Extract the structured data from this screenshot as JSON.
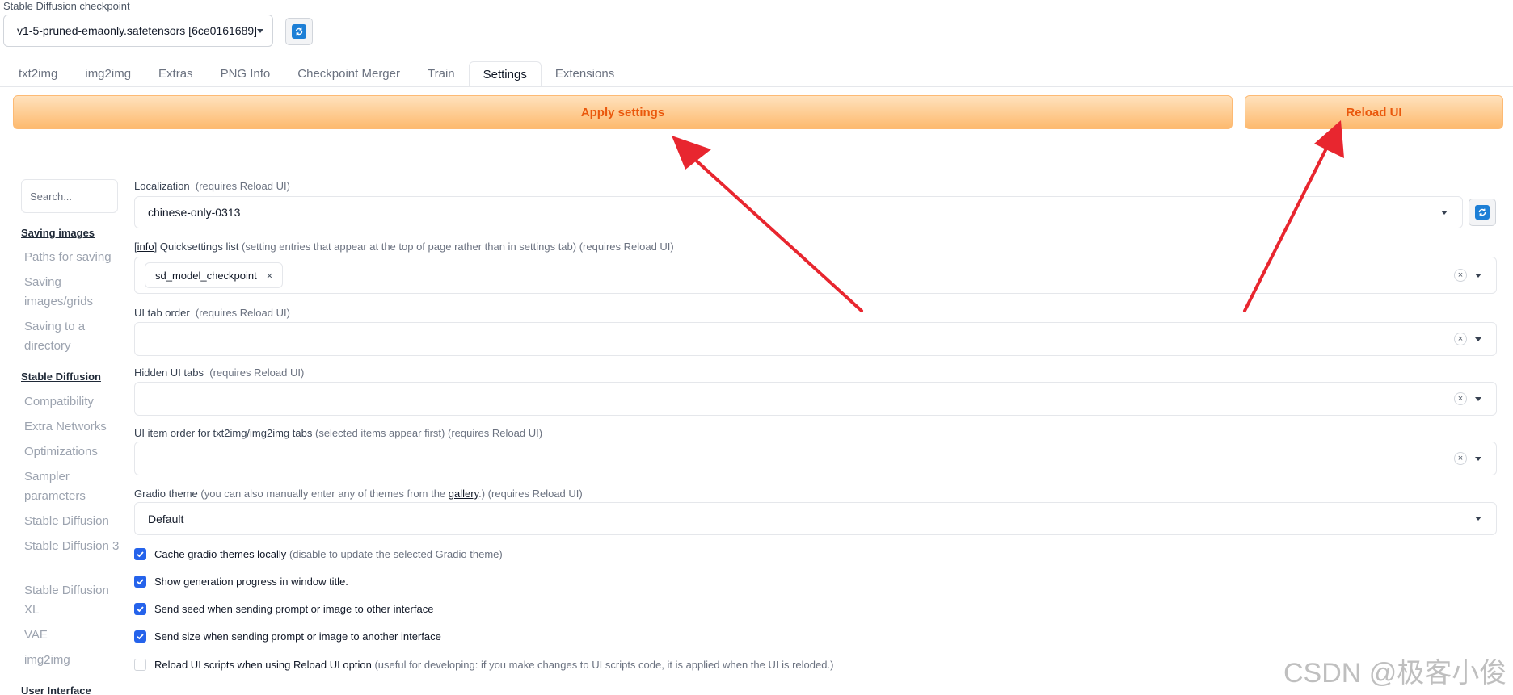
{
  "checkpoint": {
    "label": "Stable Diffusion checkpoint",
    "value": "v1-5-pruned-emaonly.safetensors [6ce0161689]",
    "refresh_icon": "refresh-icon"
  },
  "tabs": [
    "txt2img",
    "img2img",
    "Extras",
    "PNG Info",
    "Checkpoint Merger",
    "Train",
    "Settings",
    "Extensions"
  ],
  "active_tab": "Settings",
  "buttons": {
    "apply": "Apply settings",
    "reload": "Reload UI"
  },
  "sidebar": {
    "search_placeholder": "Search...",
    "groups": [
      {
        "title": "Saving images",
        "items": [
          "Paths for saving",
          "Saving images/grids",
          "Saving to a directory"
        ]
      },
      {
        "title": "Stable Diffusion",
        "items": [
          "Compatibility",
          "Extra Networks",
          "Optimizations",
          "Sampler parameters",
          "Stable Diffusion",
          "Stable Diffusion 3",
          "Stable Diffusion XL",
          "VAE",
          "img2img"
        ]
      },
      {
        "title": "User Interface",
        "items": []
      }
    ]
  },
  "settings": {
    "localization": {
      "label": "Localization",
      "note": "(requires Reload UI)",
      "value": "chinese-only-0313"
    },
    "quicksettings": {
      "info": "info",
      "label": "Quicksettings list",
      "note": "(setting entries that appear at the top of page rather than in settings tab) (requires Reload UI)",
      "chip": "sd_model_checkpoint"
    },
    "ui_tab_order": {
      "label": "UI tab order",
      "note": "(requires Reload UI)"
    },
    "hidden_ui_tabs": {
      "label": "Hidden UI tabs",
      "note": "(requires Reload UI)"
    },
    "ui_item_order": {
      "label": "UI item order for txt2img/img2img tabs",
      "note": "(selected items appear first) (requires Reload UI)"
    },
    "gradio_theme": {
      "label": "Gradio theme",
      "note_pre": "(you can also manually enter any of themes from the",
      "link": "gallery",
      "note_post": ".) (requires Reload UI)",
      "value": "Default"
    },
    "checkboxes": [
      {
        "label": "Cache gradio themes locally",
        "note": "(disable to update the selected Gradio theme)",
        "checked": true
      },
      {
        "label": "Show generation progress in window title.",
        "note": "",
        "checked": true
      },
      {
        "label": "Send seed when sending prompt or image to other interface",
        "note": "",
        "checked": true
      },
      {
        "label": "Send size when sending prompt or image to another interface",
        "note": "",
        "checked": true
      },
      {
        "label": "Reload UI scripts when using Reload UI option",
        "note": "(useful for developing: if you make changes to UI scripts code, it is applied when the UI is reloded.)",
        "checked": false
      }
    ]
  },
  "watermark": "CSDN @极客小俊",
  "colors": {
    "accent_orange": "#ea580c",
    "checkbox_blue": "#2563eb",
    "annotation_red": "#e8262f"
  }
}
